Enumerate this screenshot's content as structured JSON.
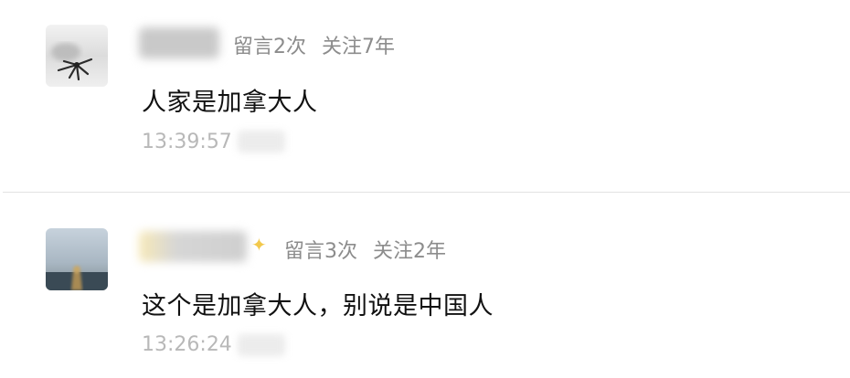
{
  "comments": [
    {
      "stats": {
        "messages": "留言2次",
        "follow": "关注7年"
      },
      "text": "人家是加拿大人",
      "time": "13:39:57"
    },
    {
      "stats": {
        "messages": "留言3次",
        "follow": "关注2年"
      },
      "text": "这个是加拿大人，别说是中国人",
      "time": "13:26:24"
    }
  ],
  "icons": {
    "badge": "sparkle-icon"
  },
  "colors": {
    "meta": "#8c8c8c",
    "time": "#b8b8b8",
    "divider": "#e2e2e2",
    "sparkle": "#f2c84b"
  }
}
